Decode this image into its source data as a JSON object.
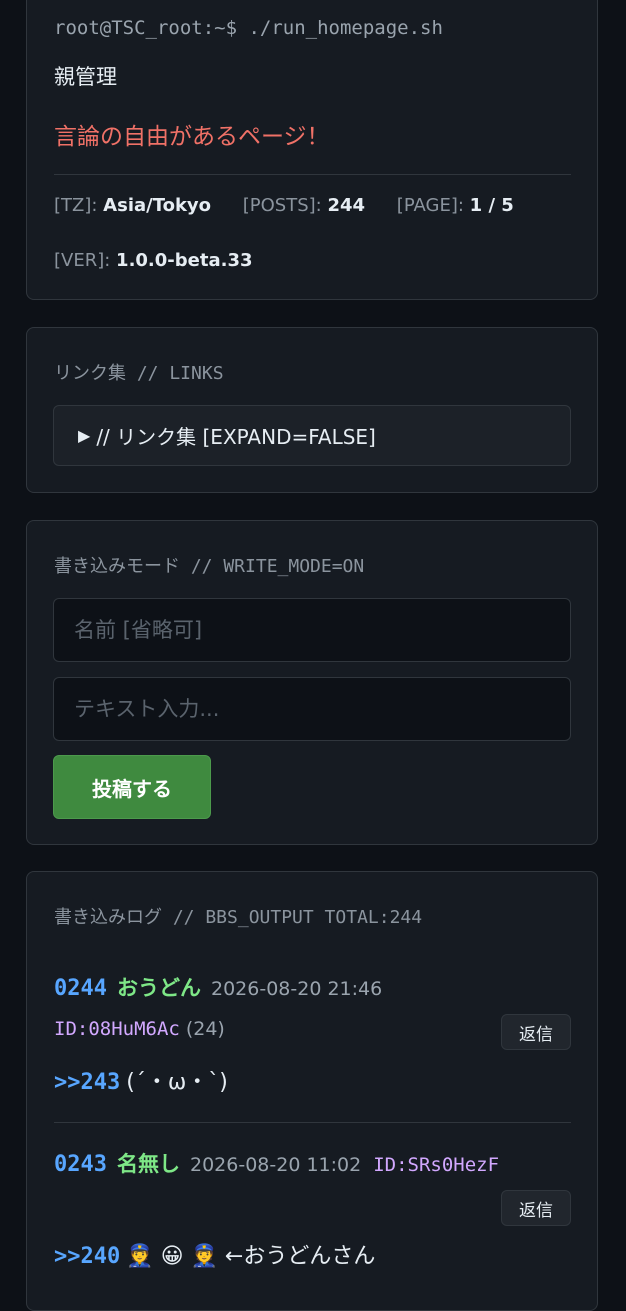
{
  "header": {
    "prompt": "root@TSC_root:~$ ./run_homepage.sh",
    "admin": "親管理",
    "tagline": "言論の自由があるページ！",
    "tz_label": "[TZ]:",
    "tz_value": "Asia/Tokyo",
    "posts_label": "[POSTS]:",
    "posts_value": "244",
    "page_label": "[PAGE]:",
    "page_value": "1 / 5",
    "ver_label": "[VER]:",
    "ver_value": "1.0.0-beta.33"
  },
  "links": {
    "title": "リンク集 // LINKS",
    "expander_label": "// リンク集 [EXPAND=FALSE]"
  },
  "write": {
    "title": "書き込みモード // WRITE_MODE=ON",
    "name_placeholder": "名前 [省略可]",
    "text_placeholder": "テキスト入力...",
    "submit_label": "投稿する"
  },
  "log": {
    "title": "書き込みログ // BBS_OUTPUT TOTAL:244",
    "posts": [
      {
        "number": "0244",
        "name": "おうどん",
        "date": "2026-08-20 21:46",
        "id": "ID:08HuM6Ac",
        "count": "(24)",
        "reply_label": "返信",
        "anchor": ">>243",
        "text": "(´・ω・`)"
      },
      {
        "number": "0243",
        "name": "名無し",
        "date": "2026-08-20 11:02",
        "id": "ID:SRs0HezF",
        "reply_label": "返信",
        "anchor": ">>240",
        "text": "👮 😀 👮 ←おうどんさん"
      }
    ]
  },
  "colors": {
    "background": "#0d1117",
    "card": "#161b22",
    "accent_red": "#f07167",
    "post_number": "#58a6ff",
    "post_name": "#7ee787",
    "post_id": "#d2a8ff",
    "submit_button": "#3f8a3f"
  },
  "icons": {
    "expander": "triangle-right-icon"
  }
}
